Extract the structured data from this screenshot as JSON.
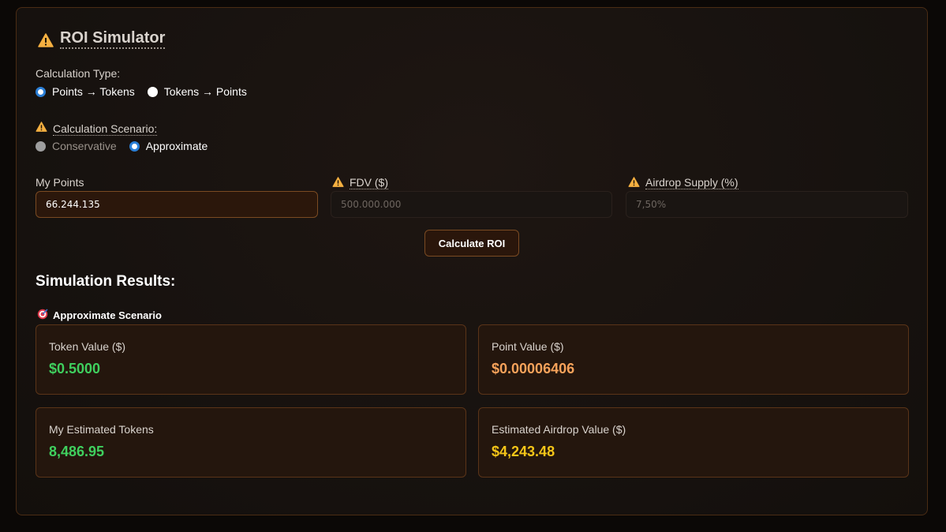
{
  "title": "ROI Simulator",
  "calculation_type": {
    "label": "Calculation Type:",
    "options": [
      {
        "label": "Points → Tokens",
        "selected": true
      },
      {
        "label": "Tokens → Points",
        "selected": false
      }
    ]
  },
  "calculation_scenario": {
    "label": "Calculation Scenario:",
    "options": [
      {
        "label": "Conservative",
        "selected": false,
        "disabled": true
      },
      {
        "label": "Approximate",
        "selected": true,
        "disabled": false
      }
    ]
  },
  "fields": {
    "my_points": {
      "label": "My Points",
      "value": "66.244.135"
    },
    "fdv": {
      "label": "FDV ($)",
      "placeholder": "500.000.000"
    },
    "airdrop_supply": {
      "label": "Airdrop Supply (%)",
      "placeholder": "7,50%"
    }
  },
  "calculate_button": "Calculate ROI",
  "results": {
    "title": "Simulation Results:",
    "scenario_label": "Approximate Scenario",
    "cards": [
      {
        "label": "Token Value ($)",
        "value": "$0.5000",
        "color": "#3fcf5e"
      },
      {
        "label": "Point Value ($)",
        "value": "$0.00006406",
        "color": "#f7a25a"
      },
      {
        "label": "My Estimated Tokens",
        "value": "8,486.95",
        "color": "#3fcf5e"
      },
      {
        "label": "Estimated Airdrop Value ($)",
        "value": "$4,243.48",
        "color": "#f5c518"
      }
    ]
  },
  "icons": {
    "warning": "warning-icon",
    "target": "target-icon"
  },
  "colors": {
    "accent_border": "#7a4a22",
    "radio_selected": "#2b7fd6",
    "warning": "#f5b041"
  }
}
